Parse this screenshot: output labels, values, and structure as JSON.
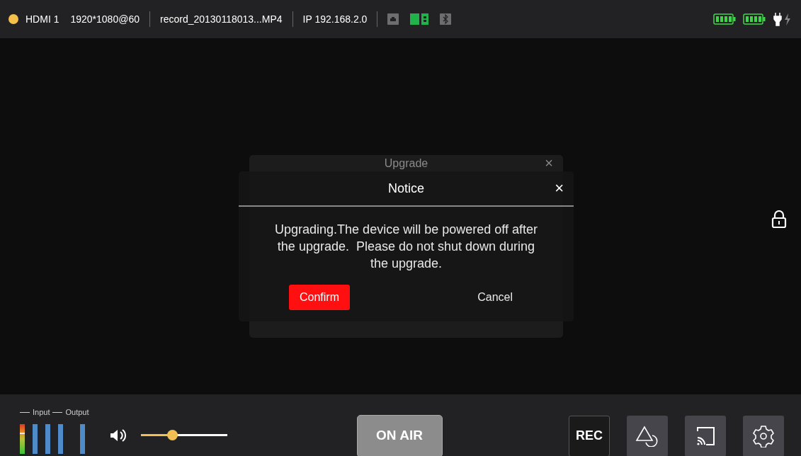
{
  "status_bar": {
    "source": {
      "label": "HDMI 1",
      "color": "#f5c04a"
    },
    "resolution": "1920*1080@60",
    "file": "record_20130118013...MP4",
    "ip": "IP 192.168.2.0",
    "connections": [
      {
        "kind": "ethernet",
        "active": false
      },
      {
        "kind": "sim",
        "active": true
      },
      {
        "kind": "bluetooth",
        "active": false
      }
    ],
    "batteries": [
      {
        "kind": "battery"
      },
      {
        "kind": "battery"
      }
    ],
    "charging": true
  },
  "background_dialog": {
    "title": "Upgrade",
    "close": "×"
  },
  "dialog": {
    "title": "Notice",
    "close": "×",
    "message": "Upgrading.The device will be powered off after the upgrade.  Please do not shut down during the upgrade.",
    "confirm": "Confirm",
    "cancel": "Cancel"
  },
  "locked": true,
  "meters": {
    "labels": [
      "Input",
      "Output"
    ],
    "channels": [
      {
        "kind": "gradient",
        "level": 0.7
      },
      {
        "kind": "plain",
        "level": 1
      },
      {
        "kind": "plain",
        "level": 1
      },
      {
        "kind": "plain",
        "level": 1
      },
      {
        "kind": "plain",
        "level": 1
      }
    ]
  },
  "volume": {
    "level": 0.36
  },
  "on_air": {
    "label": "ON AIR",
    "on": false
  },
  "toolbar": [
    {
      "kind": "rec",
      "label": "REC"
    },
    {
      "kind": "shapes"
    },
    {
      "kind": "cast"
    },
    {
      "kind": "settings"
    }
  ]
}
